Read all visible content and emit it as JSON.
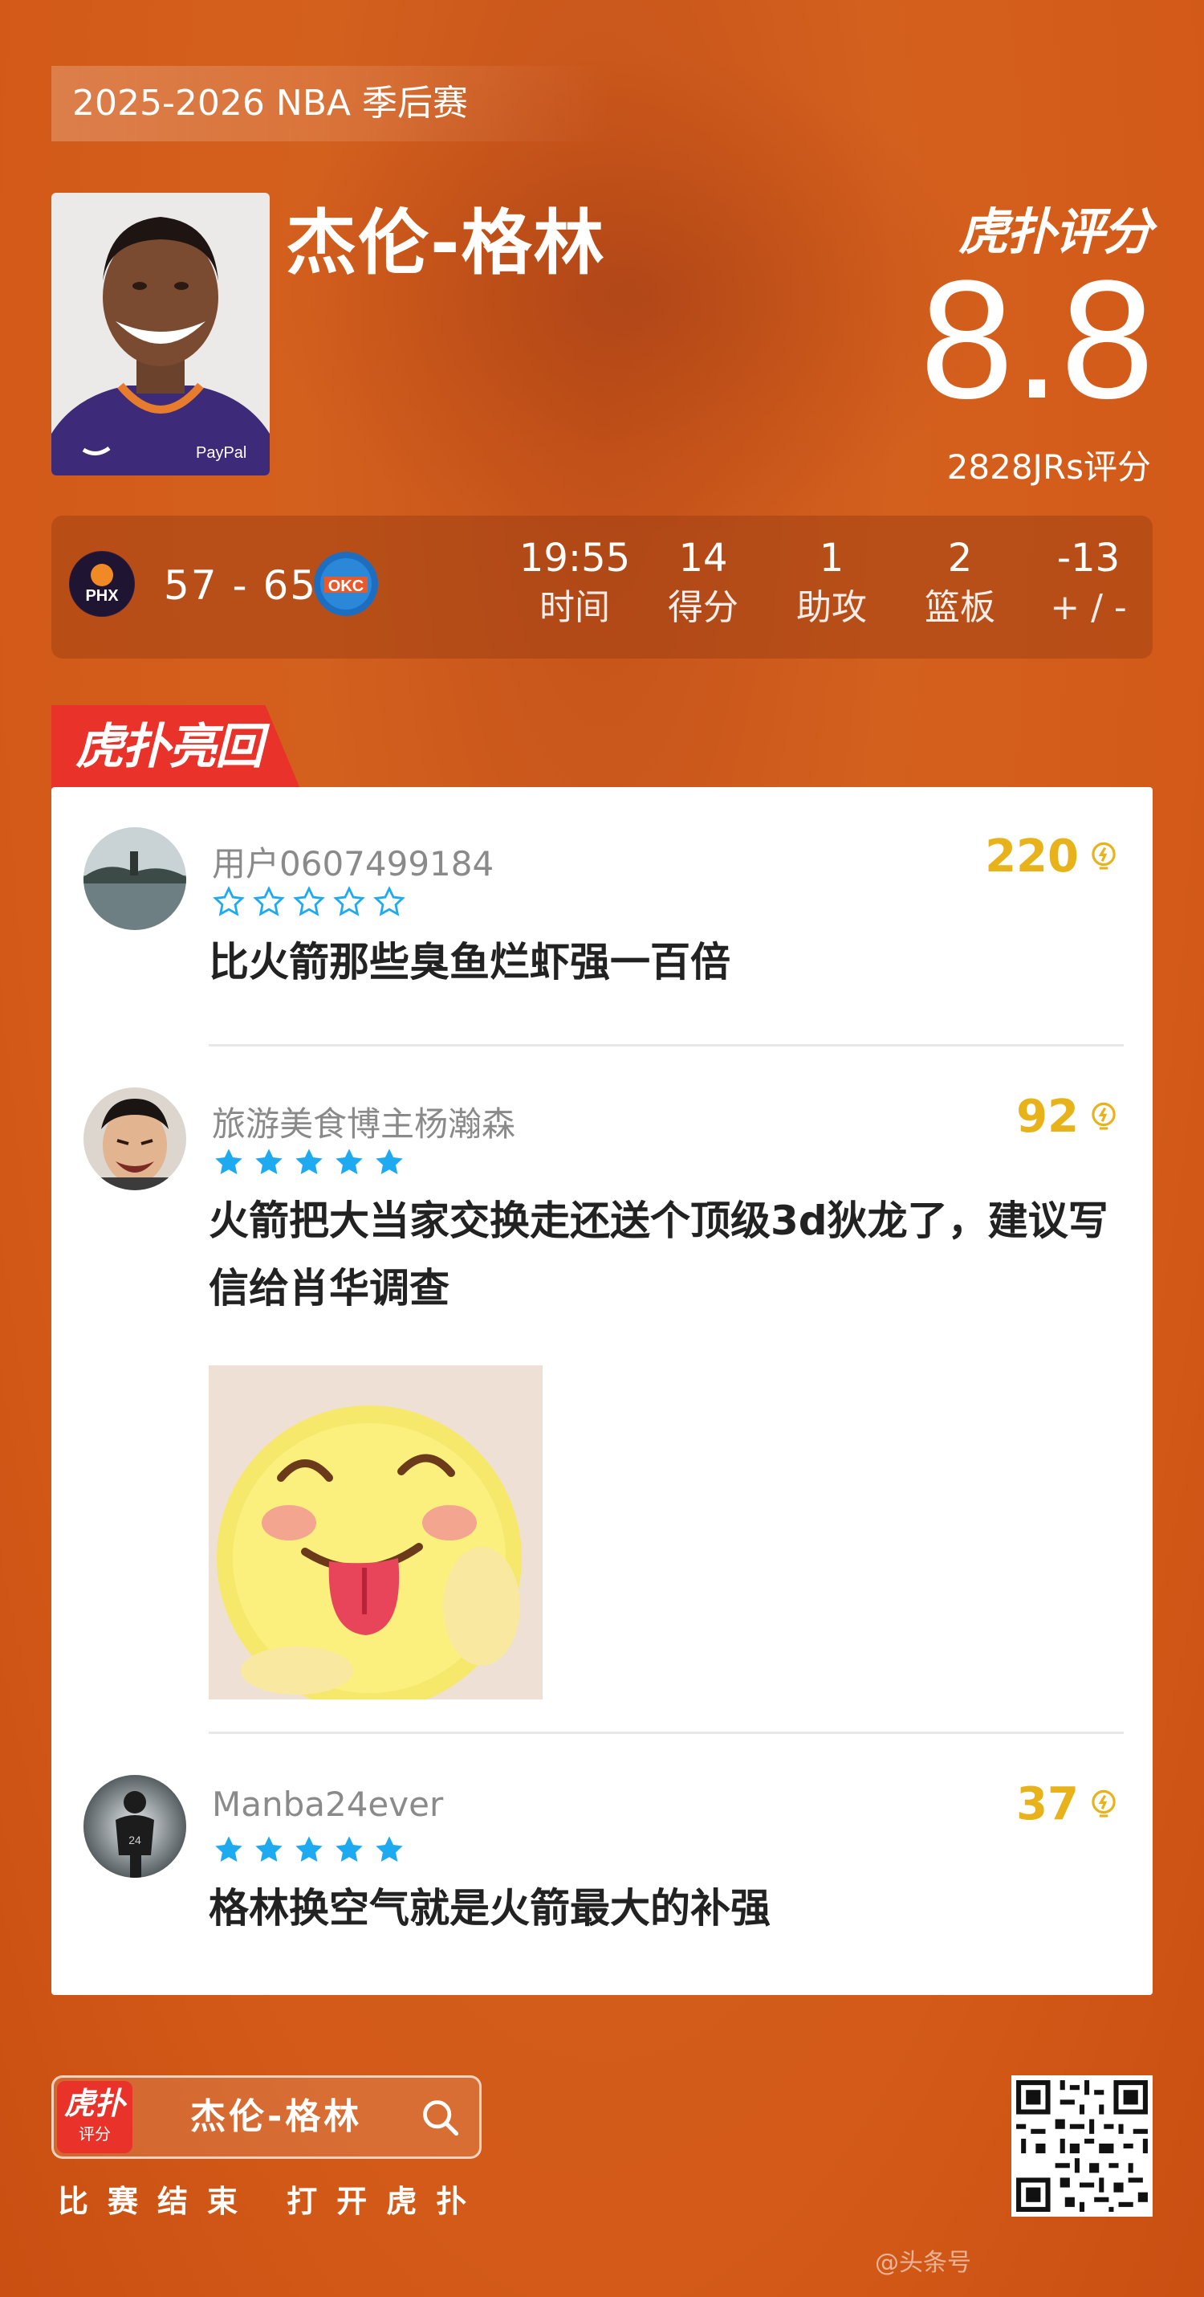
{
  "season_label": "2025-2026 NBA 季后赛",
  "player": {
    "name": "杰伦-格林"
  },
  "rating": {
    "brand": "虎扑评分",
    "score": "8.8",
    "votes_text": "2828JRs评分"
  },
  "match": {
    "home_team": "PHX",
    "away_team": "OKC",
    "score_text": "57 - 65",
    "stats": [
      {
        "value": "19:55",
        "label": "时间"
      },
      {
        "value": "14",
        "label": "得分"
      },
      {
        "value": "1",
        "label": "助攻"
      },
      {
        "value": "2",
        "label": "篮板"
      },
      {
        "value": "-13",
        "label": "+ / -"
      }
    ]
  },
  "section_tag": "虎扑亮回复",
  "comments": [
    {
      "user": "用户0607499184",
      "stars": 0,
      "likes": "220",
      "text": "比火箭那些臭鱼烂虾强一百倍"
    },
    {
      "user": "旅游美食博主杨瀚森",
      "stars": 5,
      "likes": "92",
      "text": "火箭把大当家交换走还送个顶级3d狄龙了，建议写信给肖华调查",
      "has_image": true,
      "image_icon": "tongue-thumbs-up-emoji"
    },
    {
      "user": "Manba24ever",
      "stars": 5,
      "likes": "37",
      "text": "格林换空气就是火箭最大的补强"
    }
  ],
  "footer": {
    "logo_main": "虎扑",
    "logo_sub": "评分",
    "search_name": "杰伦-格林",
    "caption": "比赛结束 打开虎扑",
    "watermark": "@头条号"
  },
  "colors": {
    "background": "#d35a18",
    "accent_red": "#e8322a",
    "likes_gold": "#e8b21a",
    "star_blue": "#1eaaf1"
  },
  "icons": [
    "search-icon",
    "lightbulb-icon",
    "star-icon",
    "qr-code"
  ]
}
